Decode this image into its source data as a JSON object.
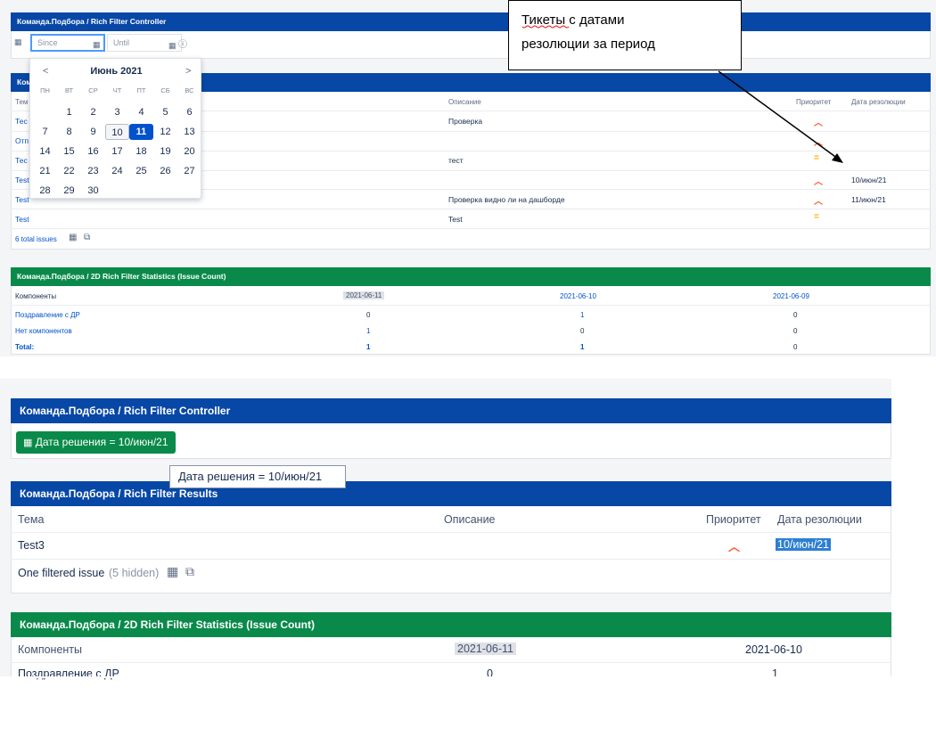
{
  "top": {
    "controller_title": "Команда.Подбора / Rich Filter Controller",
    "since_placeholder": "Since",
    "until_placeholder": "Until",
    "calendar": {
      "month": "Июнь 2021",
      "prev": "<",
      "next": ">",
      "weekdays": [
        "ПН",
        "ВТ",
        "СР",
        "ЧТ",
        "ПТ",
        "СБ",
        "ВС"
      ],
      "weeks": [
        [
          "",
          "1",
          "2",
          "3",
          "4",
          "5",
          "6"
        ],
        [
          "7",
          "8",
          "9",
          "10",
          "11",
          "12",
          "13"
        ],
        [
          "14",
          "15",
          "16",
          "17",
          "18",
          "19",
          "20"
        ],
        [
          "21",
          "22",
          "23",
          "24",
          "25",
          "26",
          "27"
        ],
        [
          "28",
          "29",
          "30",
          "",
          "",
          "",
          ""
        ]
      ],
      "today": "10",
      "selected": "11"
    },
    "results_title_visible": "Ком",
    "results_headers": {
      "topic": "Тем",
      "description": "Описание",
      "priority": "Приоритет",
      "resolution": "Дата резолюции"
    },
    "results_rows": [
      {
        "topic": "Тес",
        "description": "Проверка",
        "priority": "high",
        "resolution": ""
      },
      {
        "topic": "Отп",
        "description": "",
        "priority": "high",
        "resolution": ""
      },
      {
        "topic": "Тес",
        "description": "тест",
        "priority": "medium",
        "resolution": ""
      },
      {
        "topic": "Test",
        "description": "",
        "priority": "high",
        "resolution": "10/июн/21"
      },
      {
        "topic": "Test",
        "description": "Проверка видно ли на дашборде",
        "priority": "high",
        "resolution": "11/июн/21"
      },
      {
        "topic": "Test",
        "description": "Test",
        "priority": "medium",
        "resolution": ""
      }
    ],
    "total_issues": "6 total issues",
    "stats_title": "Команда.Подбора / 2D Rich Filter Statistics (Issue Count)",
    "stats_headers": [
      "Компоненты",
      "2021-06-11",
      "2021-06-10",
      "2021-06-09"
    ],
    "stats_rows": [
      {
        "name": "Поздравление с ДР",
        "values": [
          "0",
          "1",
          "0"
        ]
      },
      {
        "name": "Нет компонентов",
        "values": [
          "1",
          "0",
          "0"
        ]
      },
      {
        "name": "Total:",
        "values": [
          "1",
          "1",
          "0"
        ]
      }
    ]
  },
  "annotation": {
    "line1": "Тикеты с датами",
    "line2": "резолюции за период"
  },
  "bottom": {
    "controller_title": "Команда.Подбора / Rich Filter Controller",
    "filter_chip": "Дата решения = 10/июн/21",
    "tooltip": "Дата решения = 10/июн/21",
    "results_title": "Команда.Подбора / Rich Filter Results",
    "results_headers": {
      "topic": "Тема",
      "description": "Описание",
      "priority": "Приоритет",
      "resolution": "Дата резолюции"
    },
    "row": {
      "topic": "Test3",
      "resolution": "10/июн/21"
    },
    "filtered_issue": "One filtered issue",
    "hidden_note": "(5 hidden)",
    "stats_title": "Команда.Подбора / 2D Rich Filter Statistics (Issue Count)",
    "stats_headers": [
      "Компоненты",
      "2021-06-11",
      "2021-06-10"
    ],
    "stats_row": {
      "name": "Поздравление с ДР",
      "values": [
        "0",
        "1"
      ]
    }
  },
  "colors": {
    "header_blue": "#0747a6",
    "header_green": "#0a8a4a",
    "link": "#0052cc",
    "priority_high": "#ff5630",
    "priority_medium": "#ffab00"
  }
}
